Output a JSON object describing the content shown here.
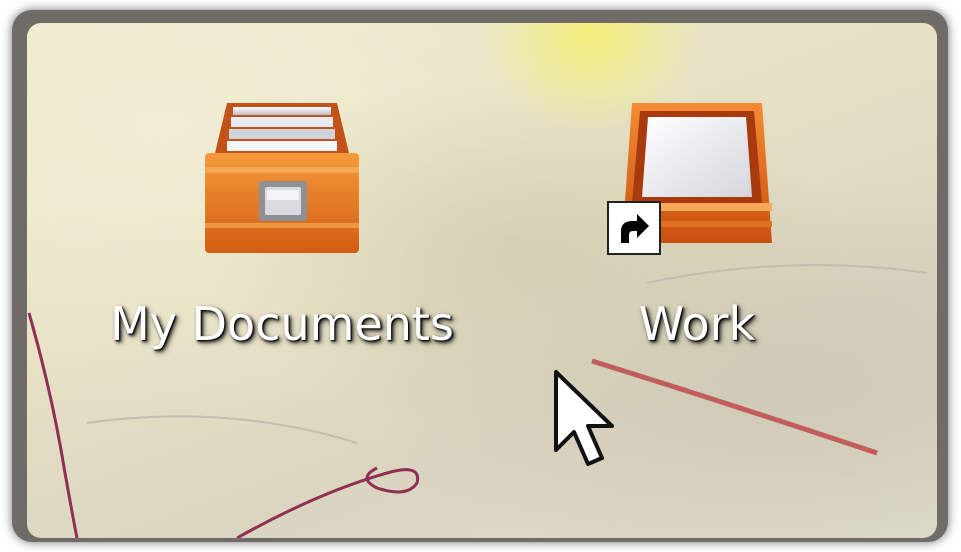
{
  "desktop": {
    "icons": [
      {
        "label": "My Documents",
        "icon": "filing-cabinet-icon",
        "shortcut": false
      },
      {
        "label": "Work",
        "icon": "inbox-tray-icon",
        "shortcut": true
      }
    ]
  },
  "colors": {
    "frame": "#6f6b67",
    "wallpaper": "#e8e2c8",
    "icon_orange": "#e8741e",
    "label_text": "#ffffff"
  }
}
